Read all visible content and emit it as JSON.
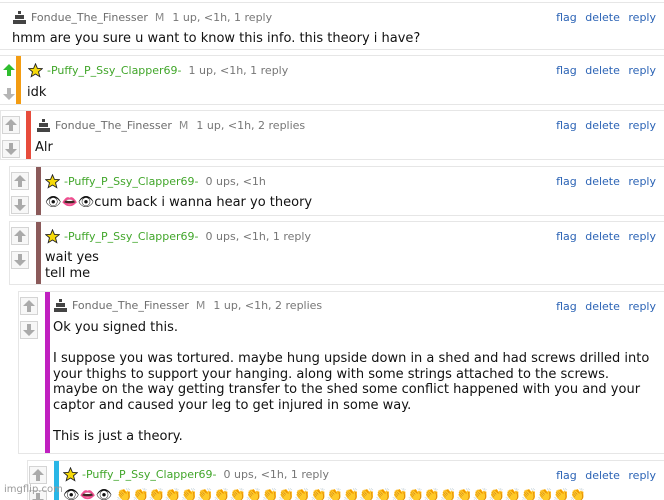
{
  "colors": {
    "link": "#2b63b5",
    "username_mod": "#6d6d6d",
    "username_star": "#41a62a",
    "bar_orange": "#f39c12",
    "bar_red": "#e74c3c",
    "bar_brown": "#8b5a5a",
    "bar_magenta": "#c020c0",
    "bar_cyan": "#29b6e6",
    "upvote_active": "#2fbd2f"
  },
  "actions": {
    "flag": "flag",
    "delete": "delete",
    "reply": "reply"
  },
  "comments": [
    {
      "username": "Fondue_The_Finesser",
      "mark": "M",
      "meta": "1 up, <1h, 1 reply",
      "body": "hmm are you sure u want to know this info. this theory i have?",
      "avatar": "mod-icon"
    },
    {
      "username": "-Puffy_P_Ssy_Clapper69-",
      "meta": "1 up, <1h, 1 reply",
      "body": "idk",
      "avatar": "star-icon"
    },
    {
      "username": "Fondue_The_Finesser",
      "mark": "M",
      "meta": "1 up, <1h, 2 replies",
      "body": "Alr",
      "avatar": "mod-icon"
    },
    {
      "username": "-Puffy_P_Ssy_Clapper69-",
      "meta": "0 ups, <1h",
      "body_emoji": "👁👄👁",
      "body": "cum back i wanna hear yo theory",
      "avatar": "star-icon"
    },
    {
      "username": "-Puffy_P_Ssy_Clapper69-",
      "meta": "0 ups, <1h, 1 reply",
      "body": "wait yes\ntell me",
      "avatar": "star-icon"
    },
    {
      "username": "Fondue_The_Finesser",
      "mark": "M",
      "meta": "1 up, <1h, 2 replies",
      "body": "Ok you signed this.\n\nI suppose you was tortured. maybe hung upside down in a shed and had screws drilled into your thighs to support your hanging. along with some strings attached to the screws. maybe on the way getting transfer to the shed some conflict happened with you and your captor and caused your leg to get injured in some way.\n\nThis is just a theory.",
      "avatar": "mod-icon"
    },
    {
      "username": "-Puffy_P_Ssy_Clapper69-",
      "meta": "0 ups, <1h, 1 reply",
      "body_emoji": "👁👄👁",
      "body": "👏👏👏👏👏👏👏👏👏👏👏👏👏👏👏👏👏👏👏👏👏👏👏👏👏👏👏👏👏",
      "avatar": "star-icon"
    }
  ],
  "watermark": "imgflip.com"
}
